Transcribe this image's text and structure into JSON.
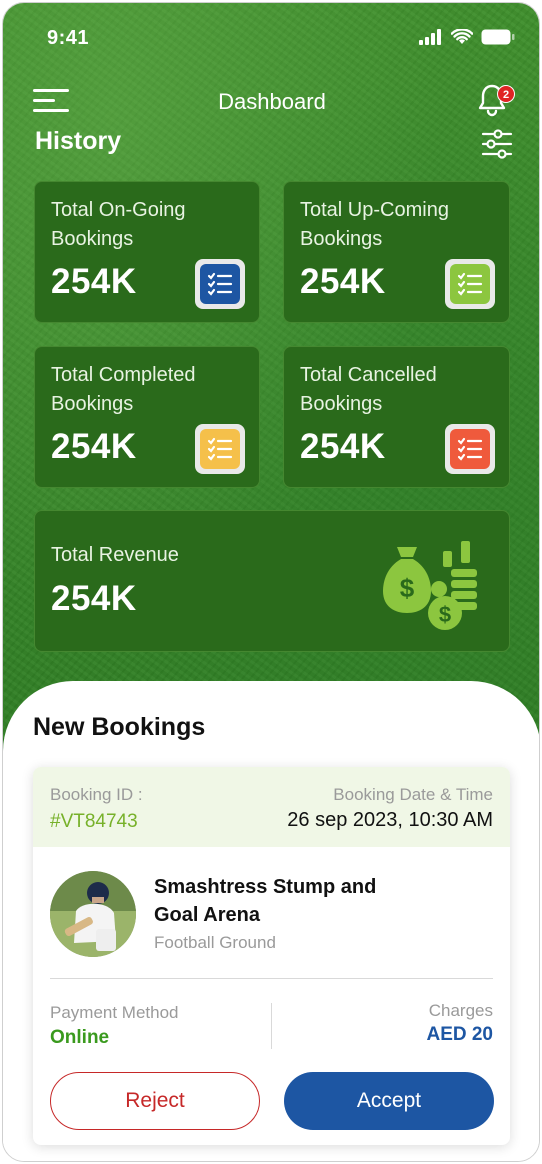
{
  "status_bar": {
    "time": "9:41"
  },
  "header": {
    "title": "Dashboard",
    "notification_count": "2"
  },
  "section": {
    "title": "History"
  },
  "stats": [
    {
      "label": "Total On-Going Bookings",
      "value": "254K",
      "icon": "checklist-icon",
      "color": "#1d56a3"
    },
    {
      "label": "Total Up-Coming Bookings",
      "value": "254K",
      "icon": "checklist-icon",
      "color": "#8cc63f"
    },
    {
      "label": "Total Completed Bookings",
      "value": "254K",
      "icon": "checklist-icon",
      "color": "#f5c04a"
    },
    {
      "label": "Total Cancelled Bookings",
      "value": "254K",
      "icon": "checklist-icon",
      "color": "#ef5a3c"
    }
  ],
  "revenue": {
    "label": "Total Revenue",
    "value": "254K",
    "icon": "money-bags-chart-icon",
    "color": "#8cc63f"
  },
  "new_bookings": {
    "title": "New Bookings",
    "booking": {
      "id_label": "Booking ID :",
      "id": "#VT84743",
      "datetime_label": "Booking Date & Time",
      "datetime": "26 sep 2023, 10:30 AM",
      "venue_name": "Smashtress Stump and Goal Arena",
      "venue_type": "Football Ground",
      "payment_label": "Payment Method",
      "payment_method": "Online",
      "charges_label": "Charges",
      "charges": "AED 20",
      "reject_label": "Reject",
      "accept_label": "Accept"
    }
  },
  "colors": {
    "brand_green": "#3a8a2a",
    "card_green": "#2a6a1b",
    "accent_blue": "#1d56a3",
    "reject_red": "#c62828",
    "online_green": "#3a9a1e"
  }
}
